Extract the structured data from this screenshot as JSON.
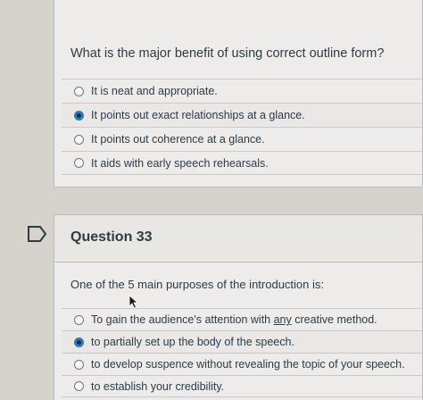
{
  "q32": {
    "prompt": "What is the major benefit of using correct outline form?",
    "answers": [
      {
        "label": "It is neat and appropriate.",
        "checked": false
      },
      {
        "label": "It points out exact relationships at a glance.",
        "checked": true
      },
      {
        "label": "It points out coherence at a glance.",
        "checked": false
      },
      {
        "label": "It aids with early speech rehearsals.",
        "checked": false
      }
    ]
  },
  "q33": {
    "title": "Question 33",
    "prompt": "One of the 5 main purposes of the introduction is:",
    "answers": [
      {
        "label_pre": "To gain the audience's attention with ",
        "label_emph": "any",
        "label_post": " creative method.",
        "checked": false
      },
      {
        "label": "to partially set up the body of the speech.",
        "checked": true
      },
      {
        "label": "to develop suspence without revealing the topic of your speech.",
        "checked": false
      },
      {
        "label": "to establish your credibility.",
        "checked": false
      }
    ]
  },
  "icons": {
    "flag": "flag-icon",
    "cursor": "mouse-pointer-icon"
  },
  "colors": {
    "radio_selected": "#2b7abc",
    "card_bg": "#eeecea"
  }
}
